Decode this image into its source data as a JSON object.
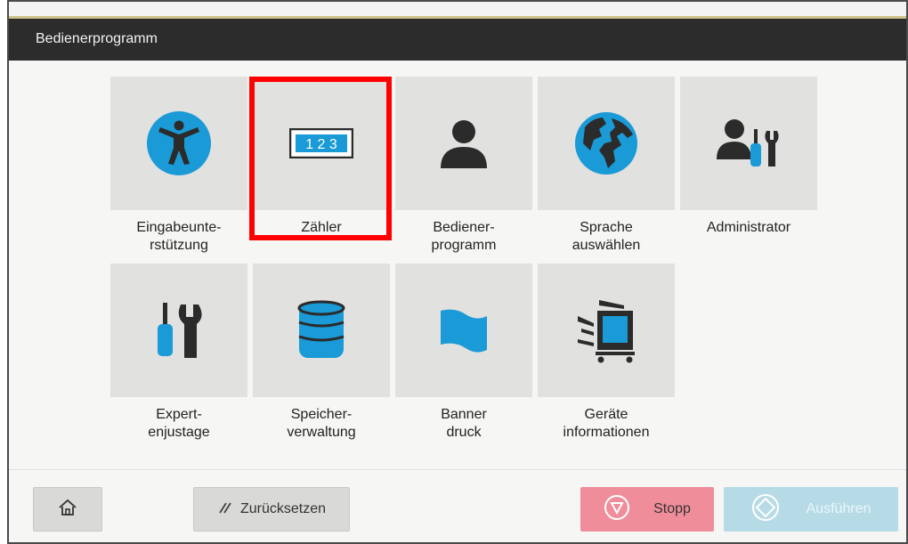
{
  "header": {
    "title": "Bedienerprogramm"
  },
  "tiles": [
    {
      "label_l1": "Eingabeunte-",
      "label_l2": "rstützung",
      "icon": "accessibility-icon"
    },
    {
      "label_l1": "Zähler",
      "label_l2": "",
      "icon": "counter-icon",
      "counter_text": "1 2 3"
    },
    {
      "label_l1": "Bediener-",
      "label_l2": "programm",
      "icon": "user-icon"
    },
    {
      "label_l1": "Sprache",
      "label_l2": "auswählen",
      "icon": "globe-icon"
    },
    {
      "label_l1": "Administrator",
      "label_l2": "",
      "icon": "admin-icon"
    },
    {
      "label_l1": "Expert-",
      "label_l2": "enjustage",
      "icon": "tools-icon"
    },
    {
      "label_l1": "Speicher-",
      "label_l2": "verwaltung",
      "icon": "storage-icon"
    },
    {
      "label_l1": "Banner",
      "label_l2": "druck",
      "icon": "banner-icon"
    },
    {
      "label_l1": "Geräte",
      "label_l2": "informationen",
      "icon": "device-icon"
    }
  ],
  "footer": {
    "home_icon": "home-icon",
    "reset_label": "Zurücksetzen",
    "stop_label": "Stopp",
    "run_label": "Ausführen"
  },
  "colors": {
    "accent_blue": "#1a9ad6",
    "dark_icon": "#2b2b2b",
    "highlight": "#ff0000",
    "stop": "#ef8e9a",
    "run": "#b7dbe6"
  }
}
